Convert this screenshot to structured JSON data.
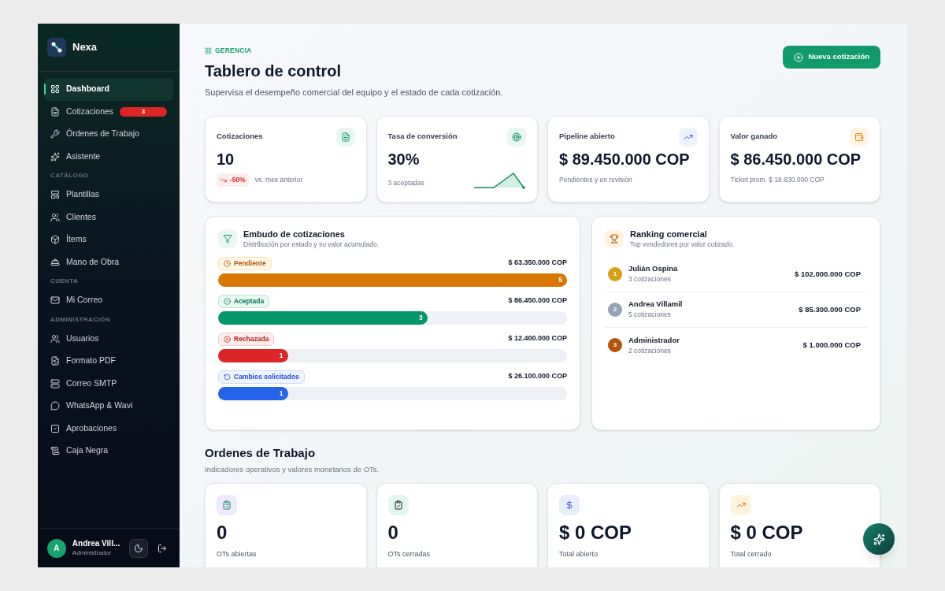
{
  "brand": {
    "name": "Nexa"
  },
  "sidebar": {
    "groups": [
      {
        "items": [
          {
            "label": "Dashboard",
            "selected": true
          },
          {
            "label": "Cotizaciones",
            "selected": false,
            "badge": "3"
          },
          {
            "label": "Órdenes de Trabajo",
            "selected": false
          },
          {
            "label": "Asistente",
            "selected": false
          }
        ]
      },
      {
        "title": "CATÁLOGO",
        "items": [
          {
            "label": "Plantillas",
            "selected": false
          },
          {
            "label": "Clientes",
            "selected": false
          },
          {
            "label": "Ítems",
            "selected": false
          },
          {
            "label": "Mano de Obra",
            "selected": false
          }
        ]
      },
      {
        "title": "CUENTA",
        "items": [
          {
            "label": "Mi Correo",
            "selected": false
          }
        ]
      },
      {
        "title": "ADMINISTRACIÓN",
        "items": [
          {
            "label": "Usuarios",
            "selected": false
          },
          {
            "label": "Formato PDF",
            "selected": false
          },
          {
            "label": "Correo SMTP",
            "selected": false
          },
          {
            "label": "WhatsApp & Wavi",
            "selected": false
          },
          {
            "label": "Aprobaciones",
            "selected": false
          },
          {
            "label": "Caja Negra",
            "selected": false
          }
        ]
      }
    ]
  },
  "user": {
    "initial": "A",
    "name": "Andrea Vill...",
    "role": "Administrador"
  },
  "header": {
    "eyebrow": "GERENCIA",
    "title": "Tablero de control",
    "subtitle": "Supervisa el desempeño comercial del equipo y el estado de cada cotización.",
    "action": "Nueva cotización"
  },
  "kpis": [
    {
      "kind": "trend",
      "title": "Cotizaciones",
      "value": "10",
      "trend": "-50%",
      "note": "vs. mes anterior"
    },
    {
      "kind": "sparkline",
      "title": "Tasa de conversión",
      "value": "30%",
      "note": "3 aceptadas"
    },
    {
      "kind": "plain",
      "title": "Pipeline abierto",
      "value": "$ 89.450.000 COP",
      "note": "Pendientes y en revisión"
    },
    {
      "kind": "plain",
      "title": "Valor ganado",
      "value": "$ 86.450.000 COP",
      "note": "Ticket prom. $ 18.830.000 COP"
    }
  ],
  "funnel": {
    "title": "Embudo de cotizaciones",
    "subtitle": "Distribución por estado y su valor acumulado.",
    "stages": [
      {
        "label": "Pendiente",
        "amount": "$ 63.350.000 COP",
        "count": "5",
        "level": 1.0,
        "color": "#d97706"
      },
      {
        "label": "Aceptada",
        "amount": "$ 86.450.000 COP",
        "count": "3",
        "level": 0.6,
        "color": "#059669"
      },
      {
        "label": "Rechazada",
        "amount": "$ 12.400.000 COP",
        "count": "1",
        "level": 0.2,
        "color": "#dc2626"
      },
      {
        "label": "Cambios solicitados",
        "amount": "$ 26.100.000 COP",
        "count": "1",
        "level": 0.2,
        "color": "#2563eb"
      }
    ]
  },
  "ranking": {
    "title": "Ranking comercial",
    "subtitle": "Top vendedores por valor cotizado.",
    "rows": [
      {
        "rank": "1",
        "name": "Julián Ospina",
        "count": "3 cotizaciones",
        "amount": "$ 102.000.000 COP",
        "color": "#d4a017"
      },
      {
        "rank": "2",
        "name": "Andrea Villamil",
        "count": "5 cotizaciones",
        "amount": "$ 85.300.000 COP",
        "color": "#94a3b8"
      },
      {
        "rank": "3",
        "name": "Administrador",
        "count": "2 cotizaciones",
        "amount": "$ 1.000.000 COP",
        "color": "#b45309"
      }
    ]
  },
  "work_orders": {
    "title": "Ordenes de Trabajo",
    "subtitle": "Indicadores operativos y valores monetarios de OTs.",
    "cards": [
      {
        "value": "0",
        "label": "OTs abiertas"
      },
      {
        "value": "0",
        "label": "OTs cerradas"
      },
      {
        "value": "$ 0 COP",
        "label": "Total abierto"
      },
      {
        "value": "$ 0 COP",
        "label": "Total cerrado"
      }
    ]
  }
}
